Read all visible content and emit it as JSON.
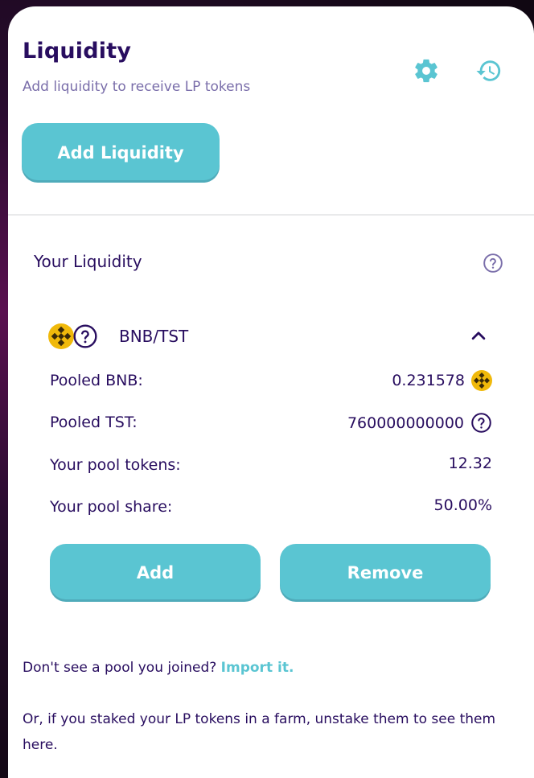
{
  "header": {
    "title": "Liquidity",
    "subtitle": "Add liquidity to receive LP tokens",
    "settings_icon": "gear-icon",
    "history_icon": "history-icon",
    "add_liquidity_label": "Add Liquidity"
  },
  "your_liquidity": {
    "heading": "Your Liquidity",
    "help_icon": "question-circle-icon",
    "pair": {
      "name": "BNB/TST",
      "expanded": true,
      "rows": [
        {
          "label": "Pooled BNB:",
          "value": "0.231578",
          "icon": "bnb-icon"
        },
        {
          "label": "Pooled TST:",
          "value": "760000000000",
          "icon": "question-circle-icon"
        },
        {
          "label": "Your pool tokens:",
          "value": "12.32"
        },
        {
          "label": "Your pool share:",
          "value": "50.00%"
        }
      ],
      "add_label": "Add",
      "remove_label": "Remove"
    }
  },
  "footer": {
    "prompt": "Don't see a pool you joined?",
    "import_link": "Import it.",
    "note": "Or, if you staked your LP tokens in a farm, unstake them to see them here."
  },
  "colors": {
    "primary": "#5ac5d2",
    "text": "#280d5f",
    "text_subtle": "#7a6eaa",
    "bnb": "#f0b90b"
  }
}
